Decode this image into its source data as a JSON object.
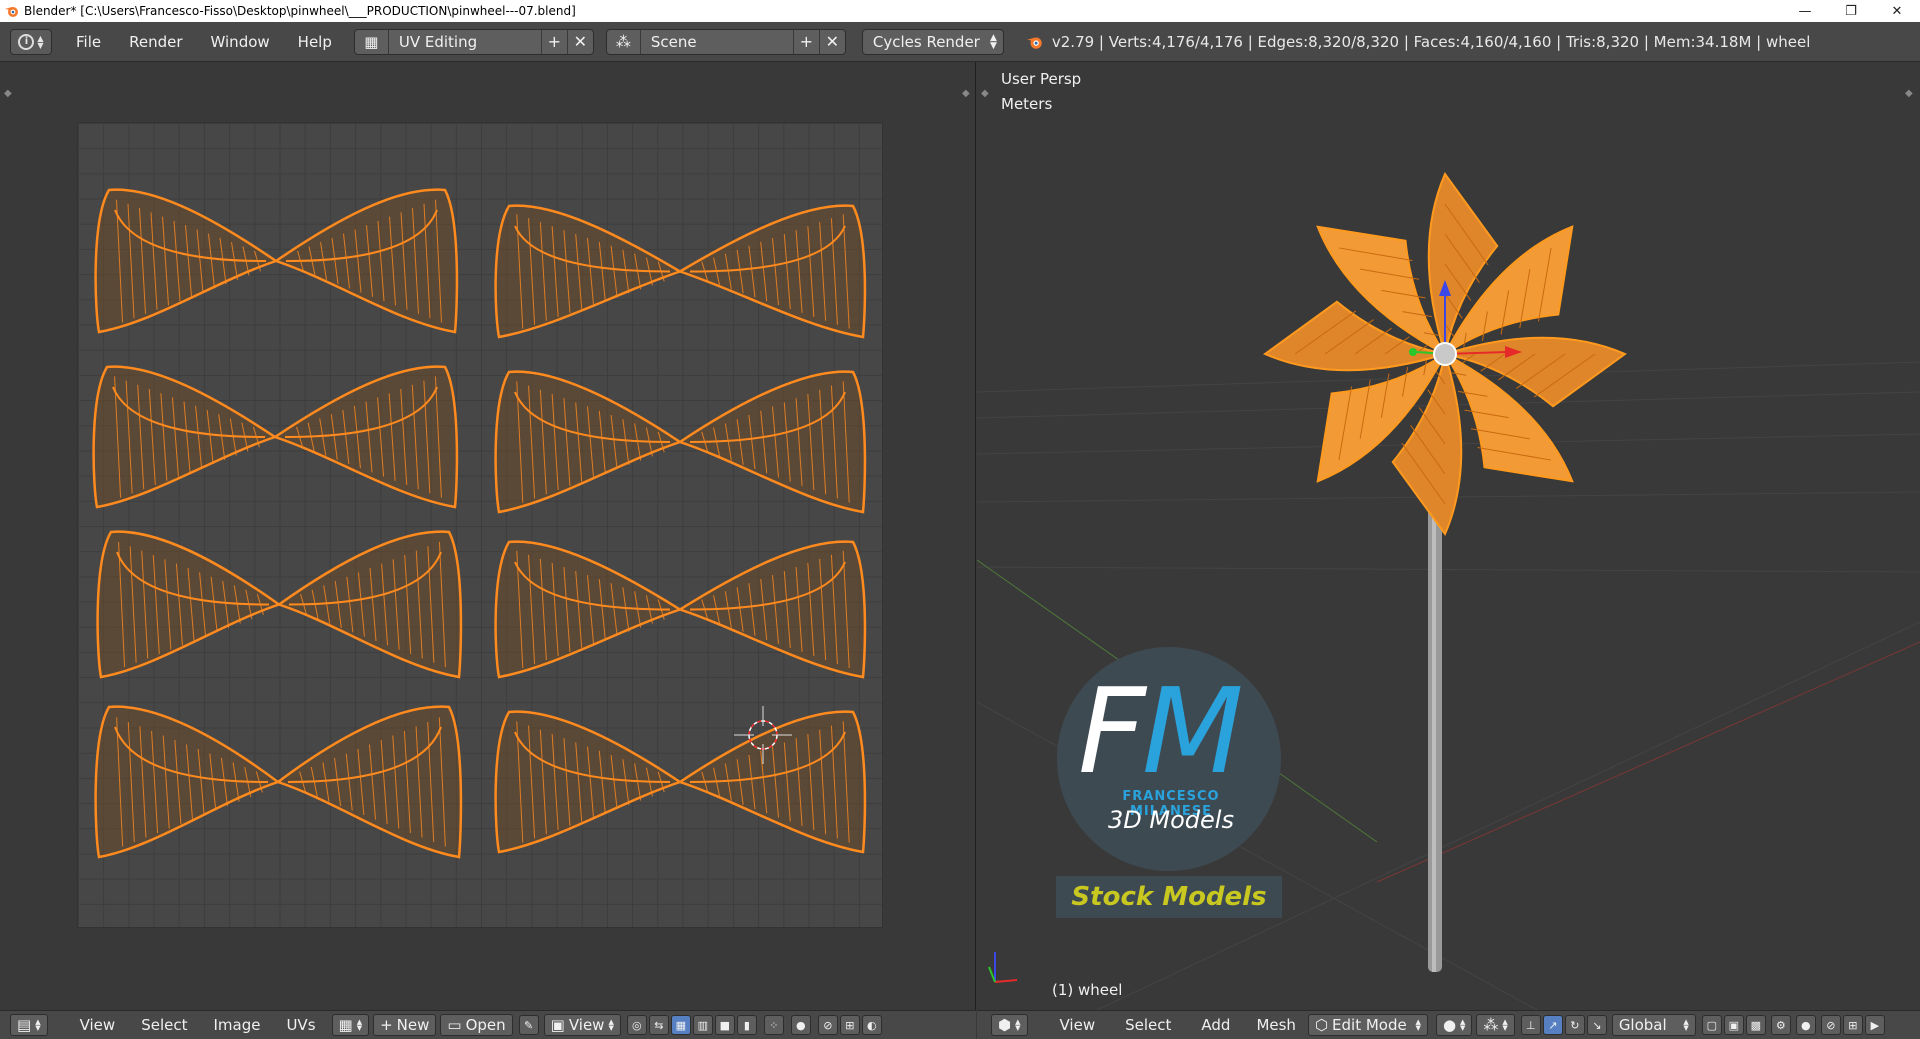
{
  "window": {
    "title": "Blender* [C:\\Users\\Francesco-Fisso\\Desktop\\pinwheel\\___PRODUCTION\\pinwheel---07.blend]",
    "minimize": "—",
    "restore": "❐",
    "close": "✕"
  },
  "info_header": {
    "menus": [
      "File",
      "Render",
      "Window",
      "Help"
    ],
    "screen_layout": "UV Editing",
    "scene": "Scene",
    "render_engine": "Cycles Render",
    "stats": "v2.79 | Verts:4,176/4,176 | Edges:8,320/8,320 | Faces:4,160/4,160 | Tris:8,320 | Mem:34.18M | wheel"
  },
  "viewport": {
    "view_name": "User Persp",
    "units": "Meters",
    "object_label": "(1) wheel"
  },
  "uv_header": {
    "menus": [
      "View",
      "Select",
      "Image",
      "UVs"
    ],
    "new_label": "New",
    "open_label": "Open",
    "view_label": "View"
  },
  "view3d_header": {
    "menus": [
      "View",
      "Select",
      "Add",
      "Mesh"
    ],
    "mode": "Edit Mode",
    "orientation": "Global"
  },
  "logo": {
    "letter_f": "F",
    "letter_m": "M",
    "name": "FRANCESCO MILANESE",
    "tagline": "3D Models",
    "badge": "Stock Models"
  },
  "colors": {
    "uv_orange": "#ff8a1e",
    "logo_blue": "#2aa3dc",
    "badge_yellow": "#c8c820"
  }
}
